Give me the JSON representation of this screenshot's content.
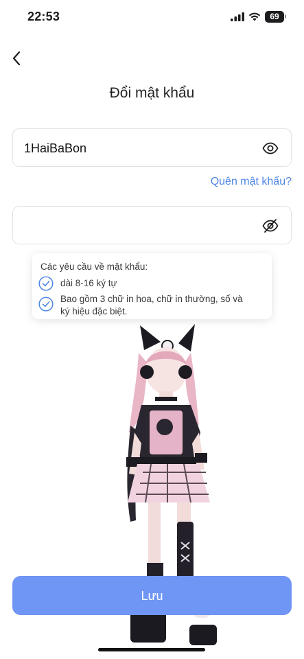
{
  "status_bar": {
    "time": "22:53",
    "battery": "69"
  },
  "header": {
    "title": "Đổi mật khẩu"
  },
  "form": {
    "current_password": {
      "value": "1HaiBaBon",
      "visibility_icon": "eye-icon"
    },
    "forgot_link": "Quên mật khẩu?",
    "new_password": {
      "value": "",
      "visibility_icon": "eye-off-icon"
    },
    "requirements": {
      "title": "Các yêu cầu về mật khẩu:",
      "items": [
        {
          "line1": "dài 8-16 ký tự",
          "line2": ""
        },
        {
          "line1": "Bao gồm 3 chữ in hoa, chữ in thường, số và",
          "line2": "ký hiệu đặc biệt."
        }
      ]
    },
    "save_label": "Lưu"
  },
  "colors": {
    "accent": "#4e86e4",
    "save_button": "#6f95f5",
    "field_border": "#e2e2e6"
  }
}
